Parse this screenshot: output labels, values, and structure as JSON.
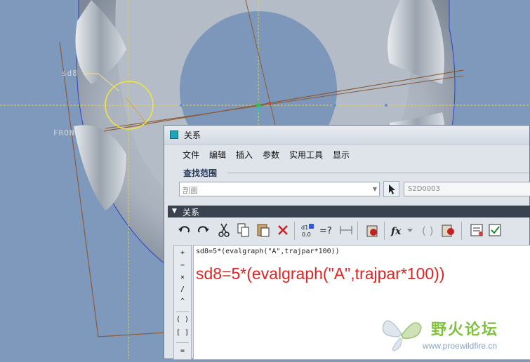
{
  "viewport": {
    "dim_label": "sd8",
    "plane_label": "FRONT"
  },
  "dialog": {
    "title": "关系",
    "menu": [
      "文件",
      "编辑",
      "插入",
      "参数",
      "实用工具",
      "显示"
    ],
    "search_group": {
      "label": "查找范围",
      "scope_value": "剖面",
      "name_value": "S2D0003"
    },
    "section_label": "关系",
    "toolbar_icons": [
      "undo-icon",
      "redo-icon",
      "cut-icon",
      "copy-icon",
      "paste-icon",
      "delete-icon",
      "switch-dims-icon",
      "evaluate-icon",
      "sort-icon",
      "insert-comment-icon",
      "function-icon",
      "dropdown-arrow-icon",
      "parentheses-icon",
      "verify-icon",
      "display-params-icon",
      "local-params-icon"
    ],
    "operators": [
      "+",
      "−",
      "×",
      "/",
      "^",
      "( )",
      "[ ]",
      "="
    ],
    "relation_text": "sd8=5*(evalgraph(\"A\",trajpar*100))",
    "annotation": "sd8=5*(evalgraph(\"A\",trajpar*100))"
  },
  "watermark": {
    "name": "野火论坛",
    "url": "www.proewildfire.cn"
  },
  "colors": {
    "background": "#7f99bd",
    "annotation_red": "#e02424",
    "logo_green": "#7fc13b"
  }
}
